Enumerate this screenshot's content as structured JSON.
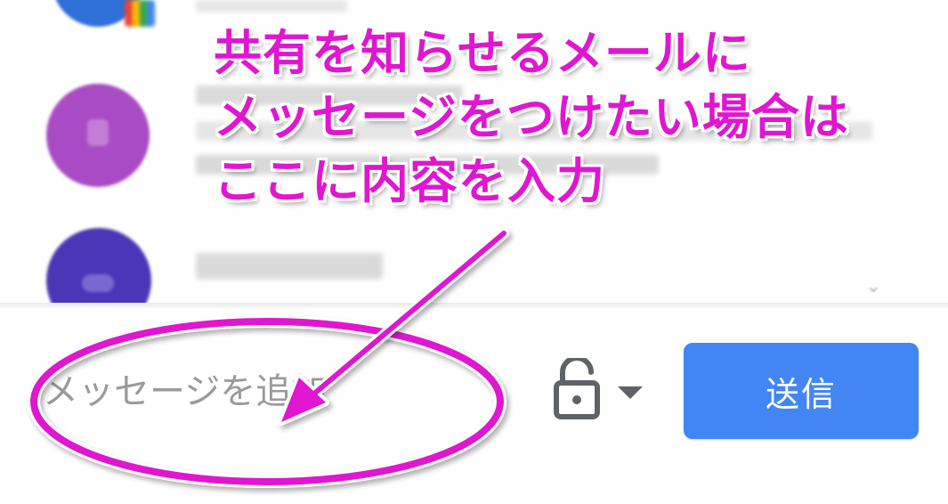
{
  "annotation": {
    "lines": [
      "共有を知らせるメールに",
      "メッセージをつけたい場合は",
      "ここに内容を入力"
    ],
    "color": "#e016d0"
  },
  "compose": {
    "message_placeholder": "メッセージを追加",
    "visibility_icon": "lock-open-icon",
    "dropdown_icon": "caret-down-icon",
    "send_label": "送信",
    "send_color": "#4286f4"
  },
  "contacts": {
    "avatar_colors": [
      "#2e6fd8",
      "#a94bc4",
      "#4b36b8"
    ]
  }
}
